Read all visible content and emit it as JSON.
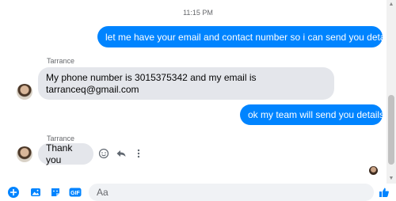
{
  "conversation": {
    "timestamp": "11:15 PM",
    "messages": [
      {
        "sender": "",
        "direction": "outgoing",
        "text": "let me have your email and contact number so i can send you details"
      },
      {
        "sender": "Tarrance",
        "direction": "incoming",
        "text": "My phone number is 3015375342 and my email is tarranceq@gmail.com"
      },
      {
        "sender": "",
        "direction": "outgoing",
        "text": "ok my team will send you details"
      },
      {
        "sender": "Tarrance",
        "direction": "incoming",
        "text": "Thank you"
      }
    ]
  },
  "composer": {
    "placeholder": "Aa",
    "icons": [
      "plus-icon",
      "photo-icon",
      "sticker-icon",
      "gif-icon",
      "emoji-icon",
      "thumbs-up-icon"
    ]
  },
  "colors": {
    "outgoing_bubble": "#0084ff",
    "incoming_bubble": "#e4e6eb",
    "accent": "#0084ff"
  }
}
